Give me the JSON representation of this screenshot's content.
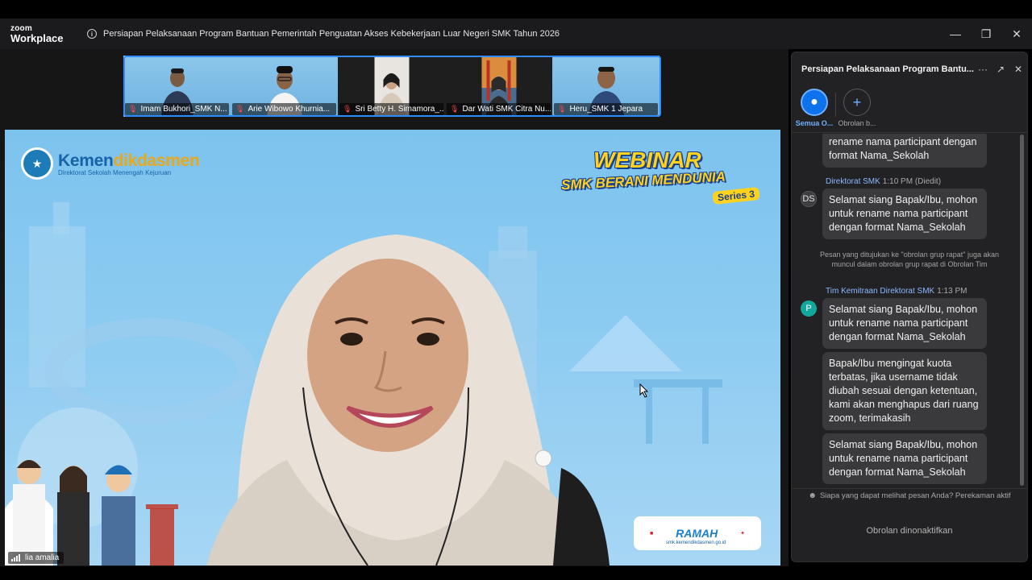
{
  "app": {
    "brand_top": "zoom",
    "brand_bottom": "Workplace",
    "meeting_title": "Persiapan Pelaksanaan Program Bantuan Pemerintah  Penguatan Akses Kebekerjaan Luar Negeri SMK Tahun 2026",
    "window_controls": [
      "minimize-icon",
      "restore-icon",
      "close-icon"
    ]
  },
  "thumbnails": [
    {
      "name": "Imam Bukhori_SMK N..."
    },
    {
      "name": "Arie Wibowo Khurnia..."
    },
    {
      "name": "Sri Betty H. Simamora_..."
    },
    {
      "name": "Dar Wati SMK Citra Nu..."
    },
    {
      "name": "Heru_SMK 1 Jepara"
    }
  ],
  "main_video": {
    "speaker_name": "lia amalia",
    "logo_main_a": "Kemen",
    "logo_main_b": "dikdasmen",
    "logo_sub": "Direktorat Sekolah Menengah Kejuruan",
    "webinar_title": "WEBINAR",
    "webinar_sub": "SMK BERANI MENDUNIA",
    "webinar_series": "Series 3",
    "partner_ramah": "RAMAH",
    "partner_url": "smk.kemendikdasmen.go.id"
  },
  "chat": {
    "title": "Persiapan Pelaksanaan Program Bantu...",
    "tabs": [
      {
        "label": "Semua O...",
        "icon": "people-icon"
      },
      {
        "label": "Obrolan b...",
        "icon": "plus-icon"
      }
    ],
    "messages": [
      {
        "text": "rename nama participant dengan format Nama_Sekolah"
      },
      {
        "sender": "Direktorat SMK",
        "time": "1:10 PM (Diedit)",
        "avatar": "DS",
        "text": "Selamat siang Bapak/Ibu, mohon untuk rename nama participant dengan format Nama_Sekolah"
      },
      {
        "system": "Pesan yang ditujukan ke \"obrolan grup rapat\" juga akan muncul dalam obrolan grup rapat di Obrolan Tim"
      },
      {
        "sender": "Tim Kemitraan Direktorat SMK",
        "time": "1:13 PM",
        "avatar": "P",
        "text": "Selamat siang Bapak/Ibu, mohon untuk rename nama participant dengan format Nama_Sekolah"
      },
      {
        "text": "Bapak/Ibu mengingat kuota terbatas, jika username tidak diubah sesuai dengan ketentuan, kami akan menghapus dari ruang zoom, terimakasih"
      },
      {
        "text": "Selamat siang Bapak/Ibu, mohon untuk rename nama participant dengan format Nama_Sekolah"
      }
    ],
    "privacy_text": "Siapa yang dapat melihat pesan Anda? Perekaman aktif",
    "disabled_text": "Obrolan dinonaktifkan"
  }
}
